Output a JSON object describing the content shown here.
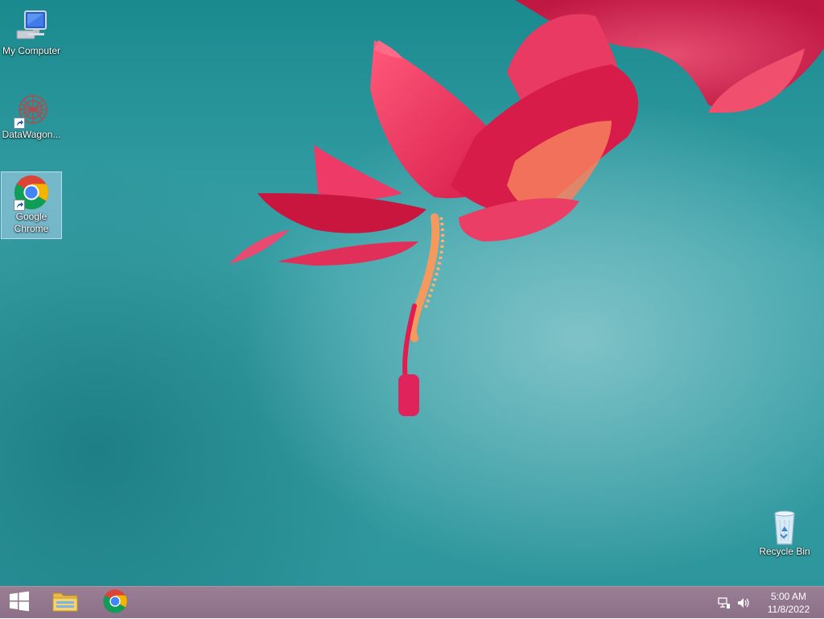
{
  "desktop": {
    "icons": [
      {
        "label": "My Computer",
        "icon": "computer-icon"
      },
      {
        "label": "DataWagon...",
        "icon": "datawagon-icon"
      },
      {
        "label": "Google Chrome",
        "icon": "chrome-icon"
      },
      {
        "label": "Recycle Bin",
        "icon": "recycle-bin-icon"
      }
    ]
  },
  "taskbar": {
    "start_icon": "windows-logo-icon",
    "pinned": [
      {
        "name": "File Explorer",
        "icon": "folder-icon"
      },
      {
        "name": "Google Chrome",
        "icon": "chrome-icon"
      }
    ],
    "tray": {
      "network_icon": "network-icon",
      "volume_icon": "volume-icon",
      "time": "5:00 AM",
      "date": "11/8/2022"
    }
  },
  "colors": {
    "taskbar": "#8c7088",
    "desktop_teal": "#2d969c",
    "flower_pink": "#e0235a"
  }
}
